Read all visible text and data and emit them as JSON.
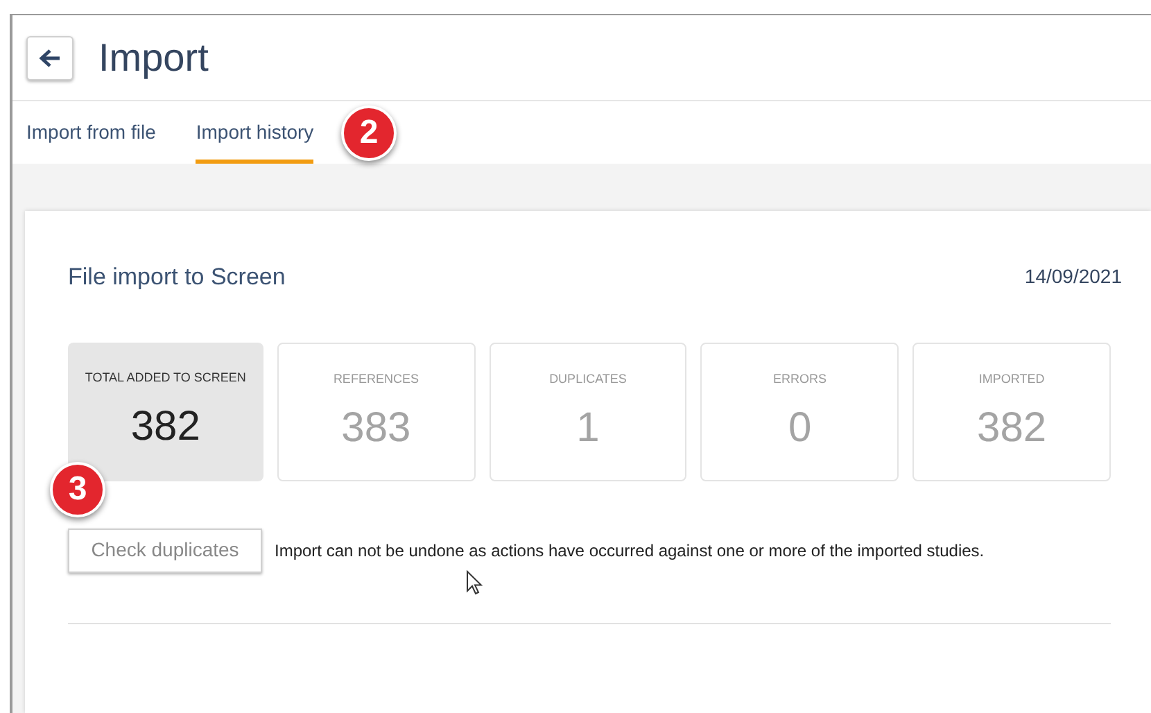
{
  "header": {
    "title": "Import"
  },
  "tabs": [
    {
      "label": "Import from file",
      "selected": false
    },
    {
      "label": "Import history",
      "selected": true
    }
  ],
  "import_record": {
    "title": "File import to Screen",
    "date": "14/09/2021",
    "stats": [
      {
        "label": "TOTAL ADDED TO SCREEN",
        "value": "382",
        "selected": true
      },
      {
        "label": "REFERENCES",
        "value": "383",
        "selected": false
      },
      {
        "label": "DUPLICATES",
        "value": "1",
        "selected": false
      },
      {
        "label": "ERRORS",
        "value": "0",
        "selected": false
      },
      {
        "label": "IMPORTED",
        "value": "382",
        "selected": false
      }
    ],
    "check_duplicates_button": "Check duplicates",
    "message": "Import can not be undone as actions have occurred against one or more of the imported studies."
  },
  "callouts": [
    "2",
    "3"
  ]
}
